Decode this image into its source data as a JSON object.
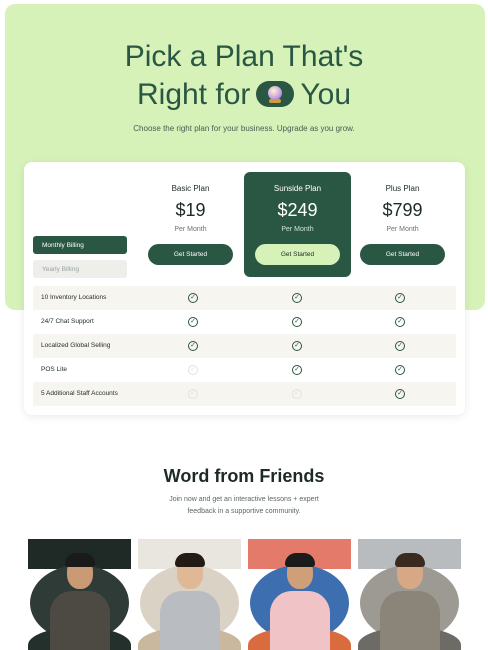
{
  "hero": {
    "title_line1": "Pick a Plan That's",
    "title_line2_before": "Right for",
    "title_line2_after": "You",
    "title_icon": "crystal-ball-icon",
    "subtitle": "Choose the right plan for your business. Upgrade as you grow."
  },
  "billing": {
    "monthly": "Monthly Billing",
    "yearly": "Yearly Billing",
    "selected": "Monthly Billing"
  },
  "plans": [
    {
      "name": "Basic Plan",
      "price": "$19",
      "period": "Per Month",
      "button": "Get Started",
      "featured": false
    },
    {
      "name": "Sunside Plan",
      "price": "$249",
      "period": "Per Month",
      "button": "Get Started",
      "featured": true
    },
    {
      "name": "Plus Plan",
      "price": "$799",
      "period": "Per Month",
      "button": "Get Started",
      "featured": false
    }
  ],
  "features": [
    {
      "label": "10 Inventory Locations",
      "included": [
        true,
        true,
        true
      ]
    },
    {
      "label": "24/7 Chat Support",
      "included": [
        true,
        true,
        true
      ]
    },
    {
      "label": "Localized Global Selling",
      "included": [
        true,
        true,
        true
      ]
    },
    {
      "label": "POS Lite",
      "included": [
        false,
        true,
        true
      ]
    },
    {
      "label": "5 Additional Staff Accounts",
      "included": [
        false,
        false,
        true
      ]
    }
  ],
  "friends": {
    "title": "Word from Friends",
    "subtitle": "Join now and get an interactive lessons + expert feedback in a supportive community."
  },
  "colors": {
    "hero_bg": "#d6f2b8",
    "brand_dark": "#2a5743",
    "row_shade": "#f7f5ef"
  },
  "icons": {
    "check": "check-circle-icon",
    "unavailable": "unavailable-check-icon"
  }
}
